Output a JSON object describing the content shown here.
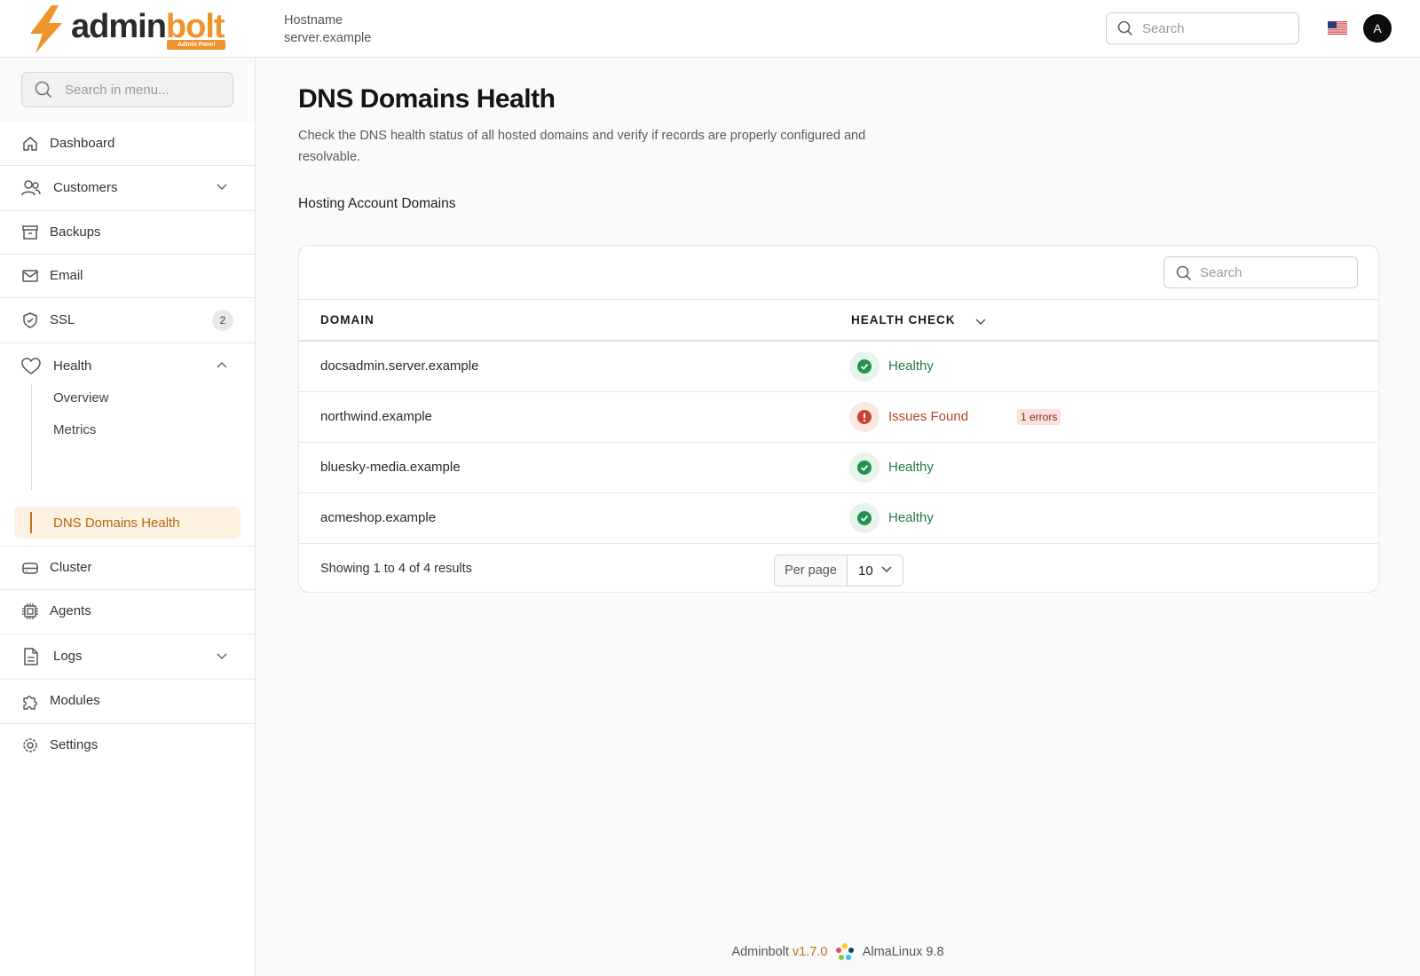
{
  "header": {
    "logo_admin": "admin",
    "logo_bolt": "bolt",
    "logo_badge": "Admin Panel",
    "hostname_label": "Hostname",
    "hostname_value": "server.example",
    "search_placeholder": "Search",
    "flag_icon": "us-flag-icon",
    "avatar_initial": "A"
  },
  "sidebar": {
    "search_placeholder": "Search in menu...",
    "items": [
      {
        "label": "Dashboard",
        "icon": "home-icon"
      },
      {
        "label": "Customers",
        "icon": "users-icon",
        "expandable": true
      },
      {
        "label": "Backups",
        "icon": "archive-icon"
      },
      {
        "label": "Email",
        "icon": "mail-icon"
      },
      {
        "label": "SSL",
        "icon": "shield-icon",
        "badge": "2"
      },
      {
        "label": "Health",
        "icon": "heart-icon",
        "expanded": true
      },
      {
        "label": "Cluster",
        "icon": "server-icon"
      },
      {
        "label": "Agents",
        "icon": "chip-icon"
      },
      {
        "label": "Logs",
        "icon": "file-icon",
        "expandable": true
      },
      {
        "label": "Modules",
        "icon": "puzzle-icon"
      },
      {
        "label": "Settings",
        "icon": "gear-icon"
      }
    ],
    "health_subitems": [
      {
        "label": "Overview"
      },
      {
        "label": "Metrics"
      },
      {
        "label": "DNS Domains Health",
        "active": true
      }
    ]
  },
  "main": {
    "title": "DNS Domains Health",
    "description": "Check the DNS health status of all hosted domains and verify if records are properly configured and resolvable.",
    "section_title": "Hosting Account Domains",
    "table": {
      "search_placeholder": "Search",
      "columns": [
        "DOMAIN",
        "HEALTH CHECK"
      ],
      "rows": [
        {
          "domain": "docsadmin.server.example",
          "status": "Healthy",
          "state": "ok",
          "badge": ""
        },
        {
          "domain": "northwind.example",
          "status": "Issues Found",
          "state": "err",
          "badge": "1 errors"
        },
        {
          "domain": "bluesky-media.example",
          "status": "Healthy",
          "state": "ok",
          "badge": ""
        },
        {
          "domain": "acmeshop.example",
          "status": "Healthy",
          "state": "ok",
          "badge": ""
        }
      ],
      "showing": "Showing 1 to 4 of 4 results",
      "per_page_label": "Per page",
      "per_page_value": "10"
    }
  },
  "footer": {
    "app_name": "Adminbolt",
    "version": "v1.7.0",
    "os": "AlmaLinux 9.8"
  },
  "colors": {
    "accent": "#f0932b",
    "healthy": "#237a45",
    "error": "#b5412c"
  }
}
